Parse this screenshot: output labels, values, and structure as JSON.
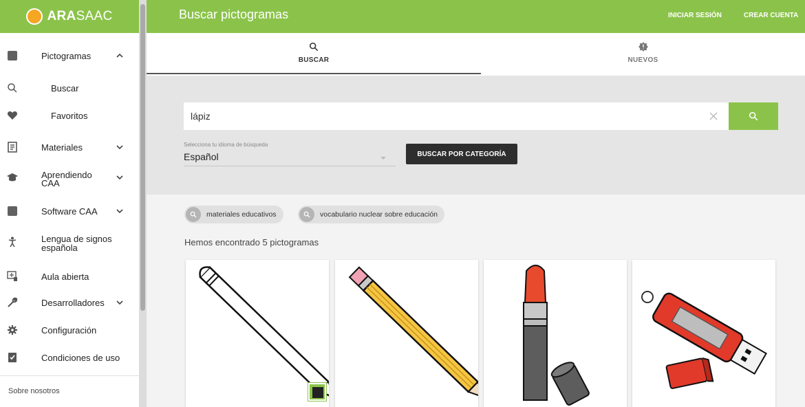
{
  "brand": {
    "prefix": "ARA",
    "suffix": "SAAC"
  },
  "sidebar": {
    "items": [
      {
        "label": "Pictogramas",
        "icon": "image-icon",
        "expanded": true
      },
      {
        "label": "Buscar",
        "icon": "search-icon"
      },
      {
        "label": "Favoritos",
        "icon": "heart-icon"
      },
      {
        "label": "Materiales",
        "icon": "newspaper-icon"
      },
      {
        "label": "Aprendiendo",
        "label2": "CAA",
        "icon": "graduation-cap-icon"
      },
      {
        "label": "Software CAA",
        "icon": "image-icon"
      },
      {
        "label": "Lengua de signos",
        "label2": "española",
        "icon": "person-icon"
      },
      {
        "label": "Aula abierta",
        "icon": "classroom-icon"
      },
      {
        "label": "Desarrolladores",
        "icon": "wrench-icon"
      },
      {
        "label": "Configuración",
        "icon": "gear-icon"
      },
      {
        "label": "Condiciones de uso",
        "icon": "checklist-icon"
      }
    ],
    "about": "Sobre nosotros"
  },
  "header": {
    "title": "Buscar pictogramas",
    "login": "INICIAR SESIÓN",
    "signup": "CREAR CUENTA"
  },
  "tabs": [
    {
      "label": "BUSCAR",
      "icon": "search-icon",
      "active": true
    },
    {
      "label": "NUEVOS",
      "icon": "new-badge-icon",
      "active": false
    }
  ],
  "search": {
    "value": "lápiz",
    "language_label": "Selecciona tu idioma de búsqueda",
    "language": "Español",
    "category_button": "BUSCAR POR CATEGORÍA"
  },
  "chips": [
    "materiales educativos",
    "vocabulario nuclear sobre educación"
  ],
  "results_text": "Hemos encontrado 5 pictogramas",
  "pictograms": [
    "pencil-outline",
    "pencil-yellow",
    "lipstick",
    "usb-drive"
  ],
  "colors": {
    "brand": "#8bc34a",
    "dark_button": "#2e2e2e"
  }
}
